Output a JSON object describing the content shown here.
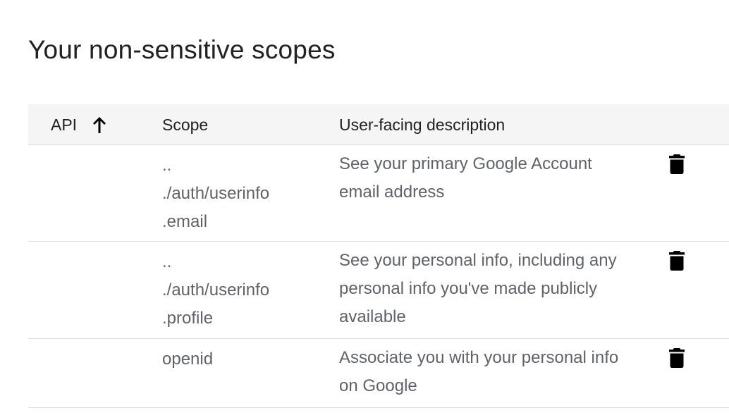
{
  "page": {
    "title": "Your non-sensitive scopes"
  },
  "table": {
    "headers": {
      "api": "API",
      "scope": "Scope",
      "description": "User-facing description"
    },
    "sort": {
      "column": "API",
      "direction": "ascending",
      "icon": "arrow-upward-icon"
    },
    "rows": [
      {
        "api": "",
        "scope": "..\n./auth/userinfo\n.email",
        "description": "See your primary Google Account email address",
        "action_icon": "delete-icon"
      },
      {
        "api": "",
        "scope": "..\n./auth/userinfo\n.profile",
        "description": "See your personal info, including any personal info you've made publicly available",
        "action_icon": "delete-icon"
      },
      {
        "api": "",
        "scope": "openid",
        "description": "Associate you with your personal info on Google",
        "action_icon": "delete-icon"
      }
    ]
  },
  "colors": {
    "header_background": "#f5f5f5",
    "divider": "#dadce0",
    "primary_text": "#202124",
    "secondary_text": "#5f6368",
    "icon": "#000000"
  }
}
